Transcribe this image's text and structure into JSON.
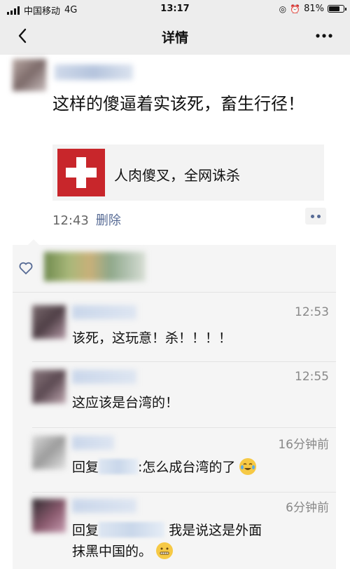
{
  "status_bar": {
    "carrier": "中国移动",
    "network": "4G",
    "time": "13:17",
    "battery": "81%",
    "battery_level": 0.81
  },
  "nav": {
    "title": "详情",
    "back_icon": "chevron-left-icon",
    "more_icon": "more-dots-icon"
  },
  "post": {
    "text": "这样的傻逼着实该死，畜生行径！",
    "link_card_title": "人肉傻叉，全网诛杀",
    "time": "12:43",
    "delete_label": "删除"
  },
  "comments": [
    {
      "time": "12:53",
      "text": "该死，这玩意！杀！！！！"
    },
    {
      "time": "12:55",
      "text": "这应该是台湾的！"
    },
    {
      "time": "16分钟前",
      "prefix": "回复",
      "text": ":怎么成台湾的了"
    },
    {
      "time": "6分钟前",
      "prefix": "回复",
      "text": "我是说这是外面",
      "text2": "抹黑中国的。"
    }
  ],
  "colors": {
    "link_blue": "#576b95",
    "bar_bg": "#ededed",
    "comment_bg": "#f5f5f5",
    "card_red": "#c8262b"
  }
}
